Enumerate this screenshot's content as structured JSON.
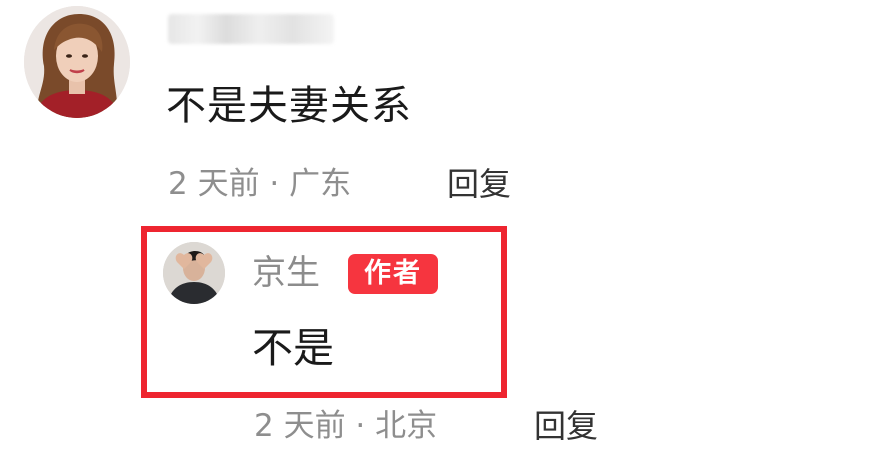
{
  "top_comment": {
    "avatar_icon": "user-avatar-woman",
    "text": "不是夫妻关系",
    "meta": "2 天前 · 广东",
    "reply_label": "回复"
  },
  "highlighted_reply": {
    "highlight_color": "#ee2530",
    "avatar_icon": "user-avatar-man",
    "username": "京生",
    "badge": "作者",
    "badge_color": "#f6353f",
    "text": "不是",
    "meta": "2 天前 · 北京",
    "reply_label": "回复"
  }
}
